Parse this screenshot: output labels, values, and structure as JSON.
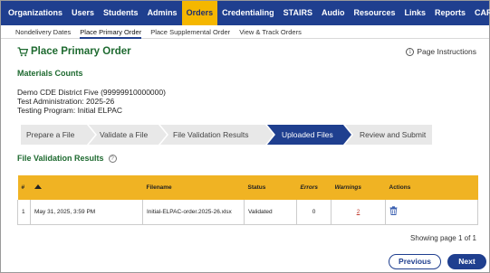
{
  "topnav": {
    "items": [
      "Organizations",
      "Users",
      "Students",
      "Admins",
      "Orders",
      "Credentialing",
      "STAIRS",
      "Audio",
      "Resources",
      "Links",
      "Reports",
      "CARS"
    ],
    "active": "Orders"
  },
  "subnav": {
    "items": [
      "Nondelivery Dates",
      "Place Primary Order",
      "Place Supplemental Order",
      "View & Track Orders"
    ],
    "active": "Place Primary Order"
  },
  "page": {
    "title": "Place Primary Order",
    "instructions": "Page Instructions",
    "section_heading": "Materials Counts",
    "district": "Demo CDE District Five (99999910000000)",
    "test_admin": "Test Administration: 2025-26",
    "testing_program": "Testing Program: Initial ELPAC"
  },
  "steps": [
    "Prepare a File",
    "Validate a File",
    "File Validation Results",
    "Uploaded Files",
    "Review and Submit"
  ],
  "active_step": "Uploaded Files",
  "results": {
    "heading": "File Validation Results",
    "columns": {
      "num": "#",
      "filename": "Filename",
      "status": "Status",
      "errors": "Errors",
      "warnings": "Warnings",
      "actions": "Actions"
    },
    "rows": [
      {
        "num": "1",
        "date": "May 31, 2025, 3:59 PM",
        "filename": "Initial-ELPAC-order.2025-26.xlsx",
        "status": "Validated",
        "errors": "0",
        "warnings": "2"
      }
    ],
    "paging": "Showing page 1 of 1"
  },
  "buttons": {
    "previous": "Previous",
    "next": "Next"
  },
  "colors": {
    "nav_bg": "#1f3f8f",
    "nav_active": "#f5b700",
    "heading_green": "#1e6a30",
    "table_header": "#f0b323"
  },
  "icons": {
    "title": "cart-icon",
    "instructions": "info-icon",
    "sort": "sort-ascending-icon",
    "delete": "trash-icon"
  }
}
